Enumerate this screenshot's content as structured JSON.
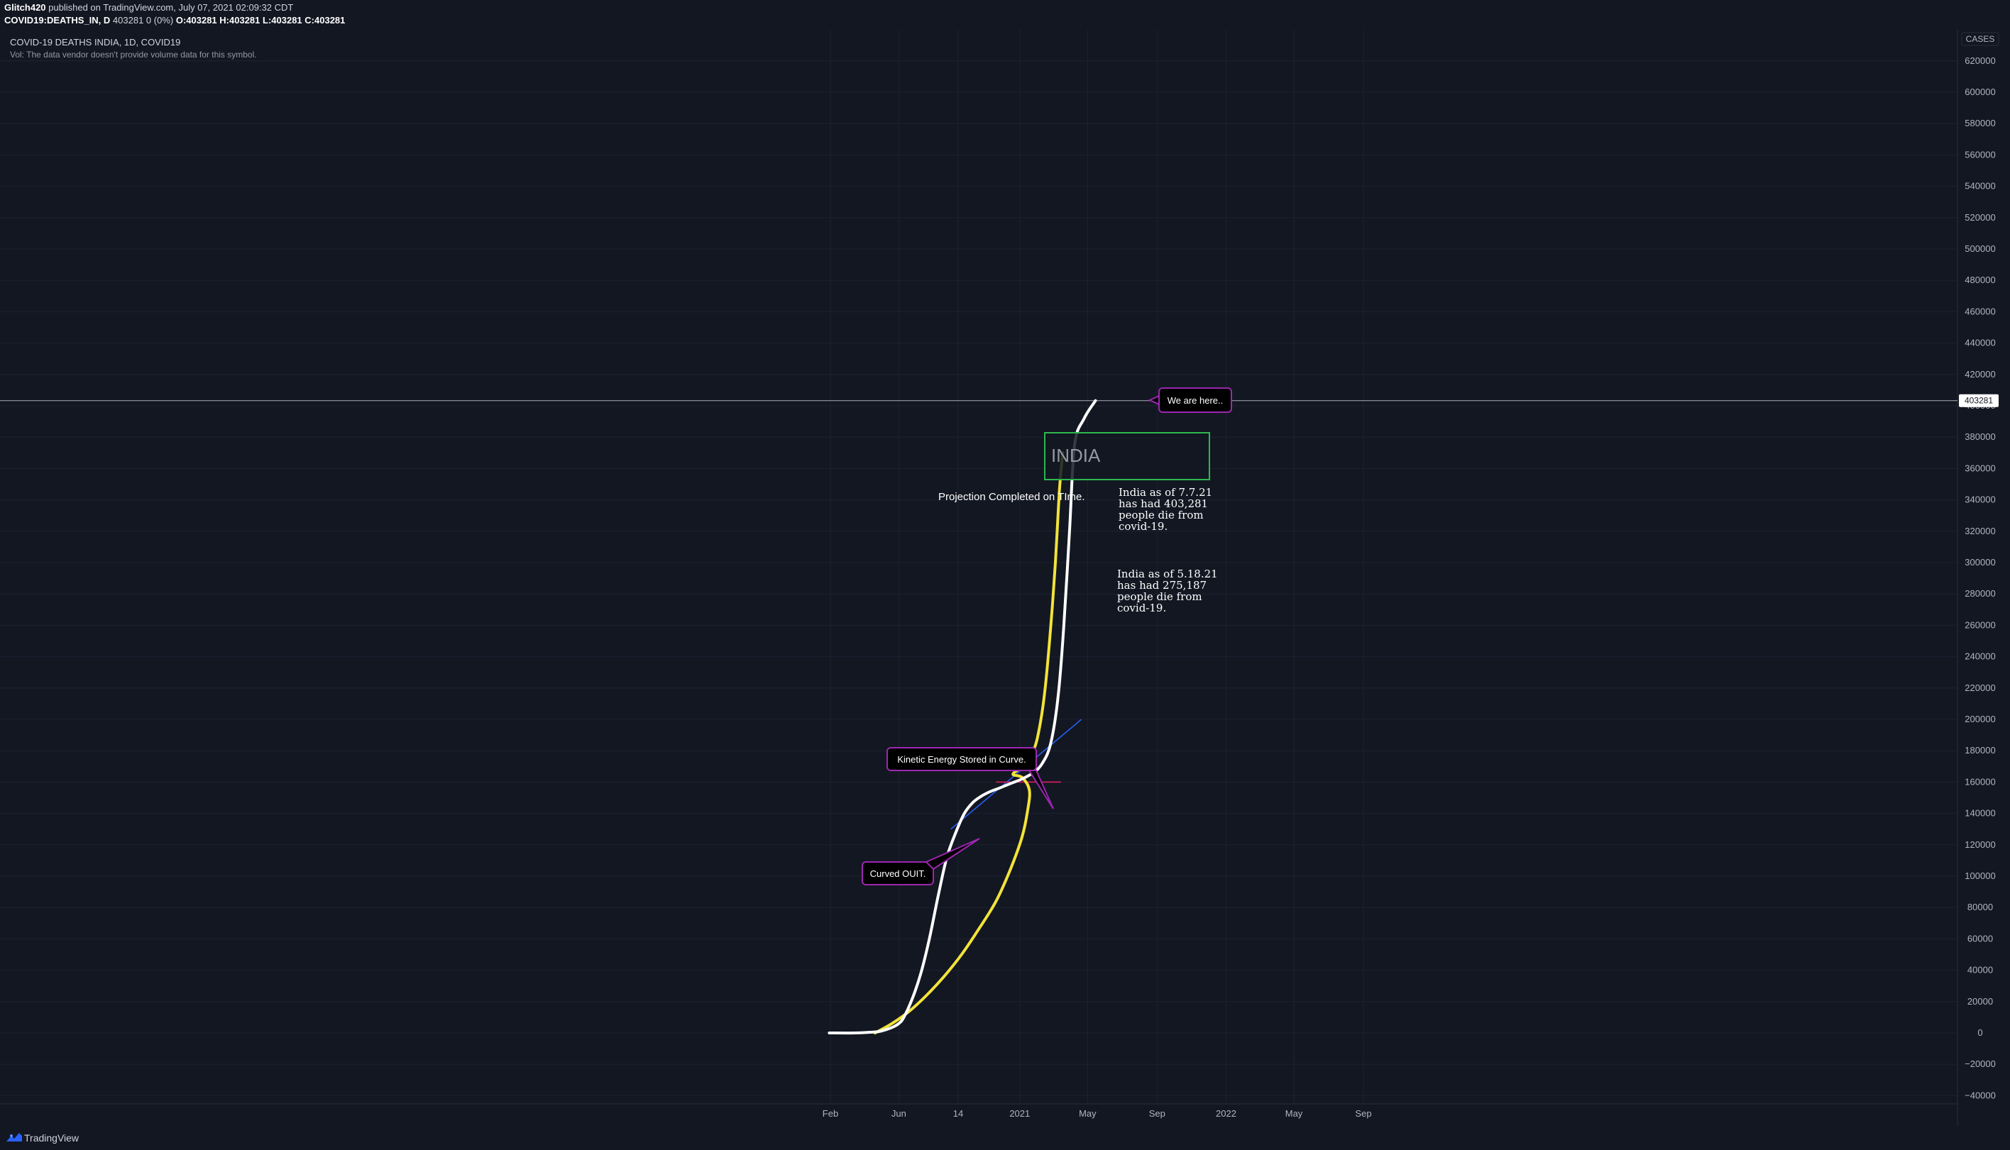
{
  "header": {
    "author": "Glitch420",
    "published": "published on TradingView.com, July 07, 2021 02:09:32 CDT",
    "symbol": "COVID19:DEATHS_IN, D",
    "quote": "403281 0 (0%)",
    "open": "O:403281",
    "high": "H:403281",
    "low": "L:403281",
    "close": "C:403281"
  },
  "legend": {
    "title": "COVID-19 DEATHS INDIA, 1D, COVID19",
    "volume_note": "Vol: The data vendor doesn't provide volume data for this symbol."
  },
  "footer": {
    "brand": "TradingView"
  },
  "colors": {
    "background": "#131722",
    "grid": "#1e2230",
    "text": "#b2b5be",
    "series": "#ffffff",
    "projection": "#f2e33a",
    "trendline": "#2962ff",
    "support": "#e91e63",
    "callout_border": "#9c27b0",
    "box_border": "#2db84d"
  },
  "chart_data": {
    "type": "line",
    "y_axis_unit": "CASES",
    "ylim": [
      -40000,
      630000
    ],
    "y_ticks": [
      -40000,
      -20000,
      0,
      20000,
      40000,
      60000,
      80000,
      100000,
      120000,
      140000,
      160000,
      180000,
      200000,
      220000,
      240000,
      260000,
      280000,
      300000,
      320000,
      340000,
      360000,
      380000,
      400000,
      420000,
      440000,
      460000,
      480000,
      500000,
      520000,
      540000,
      560000,
      580000,
      600000,
      620000
    ],
    "y_tick_labels": [
      "−40000",
      "−20000",
      "0",
      "20000",
      "40000",
      "60000",
      "80000",
      "100000",
      "120000",
      "140000",
      "160000",
      "180000",
      "200000",
      "220000",
      "240000",
      "260000",
      "280000",
      "300000",
      "320000",
      "340000",
      "360000",
      "380000",
      "400000",
      "420000",
      "440000",
      "460000",
      "480000",
      "500000",
      "520000",
      "540000",
      "560000",
      "580000",
      "600000",
      "620000"
    ],
    "xlim": [
      "2019-12-01",
      "2022-11-20"
    ],
    "x_ticks": [
      {
        "date": "2020-02-01",
        "label": "Feb"
      },
      {
        "date": "2020-06-01",
        "label": "Jun"
      },
      {
        "date": "2020-09-14",
        "label": "14"
      },
      {
        "date": "2021-01-01",
        "label": "2021"
      },
      {
        "date": "2021-05-01",
        "label": "May"
      },
      {
        "date": "2021-09-01",
        "label": "Sep"
      },
      {
        "date": "2022-01-01",
        "label": "2022"
      },
      {
        "date": "2022-05-01",
        "label": "May"
      },
      {
        "date": "2022-09-01",
        "label": "Sep"
      }
    ],
    "last_value": 403281,
    "last_value_label": "403281",
    "grid": true,
    "series": [
      {
        "points": [
          [
            "2020-01-30",
            0
          ],
          [
            "2020-03-15",
            0
          ],
          [
            "2020-04-15",
            500
          ],
          [
            "2020-05-01",
            1200
          ],
          [
            "2020-05-20",
            3500
          ],
          [
            "2020-06-01",
            6000
          ],
          [
            "2020-06-10",
            10000
          ],
          [
            "2020-06-25",
            22000
          ],
          [
            "2020-07-10",
            38000
          ],
          [
            "2020-07-25",
            60000
          ],
          [
            "2020-08-10",
            88000
          ],
          [
            "2020-08-25",
            112000
          ],
          [
            "2020-09-10",
            128000
          ],
          [
            "2020-09-25",
            140000
          ],
          [
            "2020-10-10",
            147000
          ],
          [
            "2020-10-25",
            151000
          ],
          [
            "2020-11-10",
            154000
          ],
          [
            "2020-11-25",
            156000
          ],
          [
            "2020-12-15",
            159000
          ],
          [
            "2021-01-05",
            162000
          ],
          [
            "2021-01-25",
            166000
          ],
          [
            "2021-02-10",
            172000
          ],
          [
            "2021-02-25",
            185000
          ],
          [
            "2021-03-10",
            215000
          ],
          [
            "2021-03-20",
            260000
          ],
          [
            "2021-03-30",
            320000
          ],
          [
            "2021-04-08",
            375000
          ],
          [
            "2021-04-25",
            392000
          ],
          [
            "2021-05-15",
            403281
          ]
        ]
      },
      {
        "points": [
          [
            "2020-04-20",
            0
          ],
          [
            "2020-05-20",
            6000
          ],
          [
            "2020-06-20",
            14000
          ],
          [
            "2020-07-20",
            24000
          ],
          [
            "2020-08-20",
            36000
          ],
          [
            "2020-09-20",
            50000
          ],
          [
            "2020-10-20",
            66000
          ],
          [
            "2020-11-20",
            84000
          ],
          [
            "2020-12-15",
            104000
          ],
          [
            "2021-01-05",
            125000
          ],
          [
            "2021-01-15",
            142000
          ],
          [
            "2021-01-18",
            155000
          ],
          [
            "2021-01-05",
            163000
          ],
          [
            "2020-12-20",
            165000
          ],
          [
            "2021-01-05",
            170000
          ],
          [
            "2021-01-25",
            180000
          ],
          [
            "2021-02-05",
            195000
          ],
          [
            "2021-02-15",
            220000
          ],
          [
            "2021-02-25",
            260000
          ],
          [
            "2021-03-05",
            300000
          ],
          [
            "2021-03-12",
            345000
          ],
          [
            "2021-03-18",
            370000
          ]
        ]
      }
    ],
    "trendline": [
      [
        "2020-09-01",
        130000
      ],
      [
        "2021-04-20",
        200000
      ]
    ],
    "support_line": [
      [
        "2020-11-20",
        160000
      ],
      [
        "2021-03-15",
        160000
      ]
    ],
    "annotations": {
      "we_are_here": "We are here..",
      "region_label": "INDIA",
      "projection_note": "Projection Completed on TIme.",
      "note_july": [
        "India as of 7.7.21",
        "has had 403,281",
        "people die from",
        "covid-19."
      ],
      "note_may": [
        "India as of 5.18.21",
        "has had 275,187",
        "people die from",
        "covid-19."
      ],
      "kinetic": "Kinetic Energy Stored in Curve.",
      "curved_out": "Curved OUIT."
    }
  }
}
